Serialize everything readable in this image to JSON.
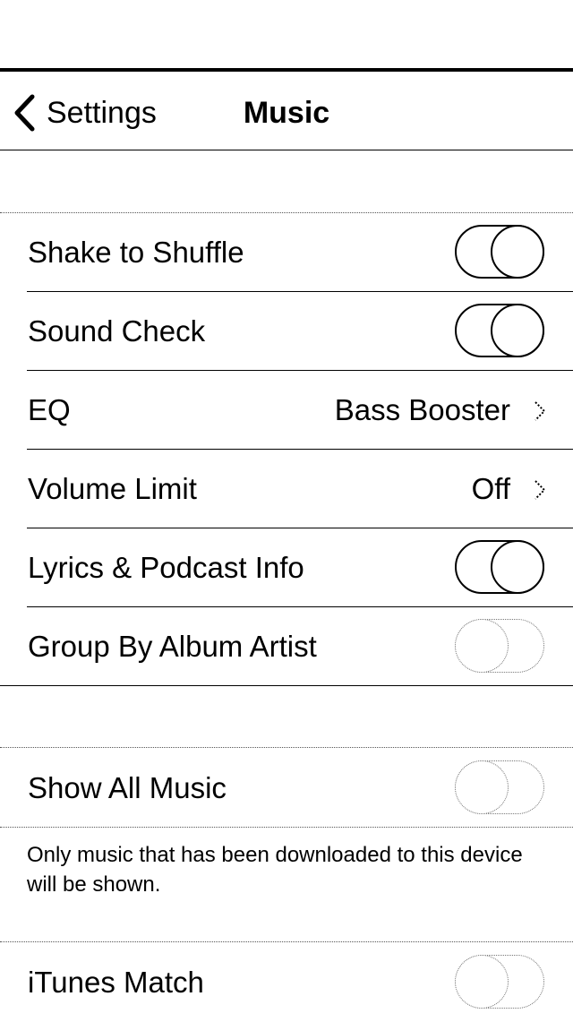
{
  "nav": {
    "back_label": "Settings",
    "title": "Music"
  },
  "group1": [
    {
      "label": "Shake to Shuffle",
      "type": "toggle",
      "on": true
    },
    {
      "label": "Sound Check",
      "type": "toggle",
      "on": true
    },
    {
      "label": "EQ",
      "type": "disclosure",
      "value": "Bass Booster"
    },
    {
      "label": "Volume Limit",
      "type": "disclosure",
      "value": "Off"
    },
    {
      "label": "Lyrics & Podcast Info",
      "type": "toggle",
      "on": true
    },
    {
      "label": "Group By Album Artist",
      "type": "toggle",
      "on": false
    }
  ],
  "group2": {
    "show_all_music": {
      "label": "Show All Music",
      "on": false
    },
    "footer": "Only music that has been downloaded to this device will be shown."
  },
  "group3": {
    "itunes_match": {
      "label": "iTunes Match",
      "on": false
    }
  },
  "icons": {
    "back": "chevron-left-icon",
    "disclosure": "chevron-right-icon"
  }
}
